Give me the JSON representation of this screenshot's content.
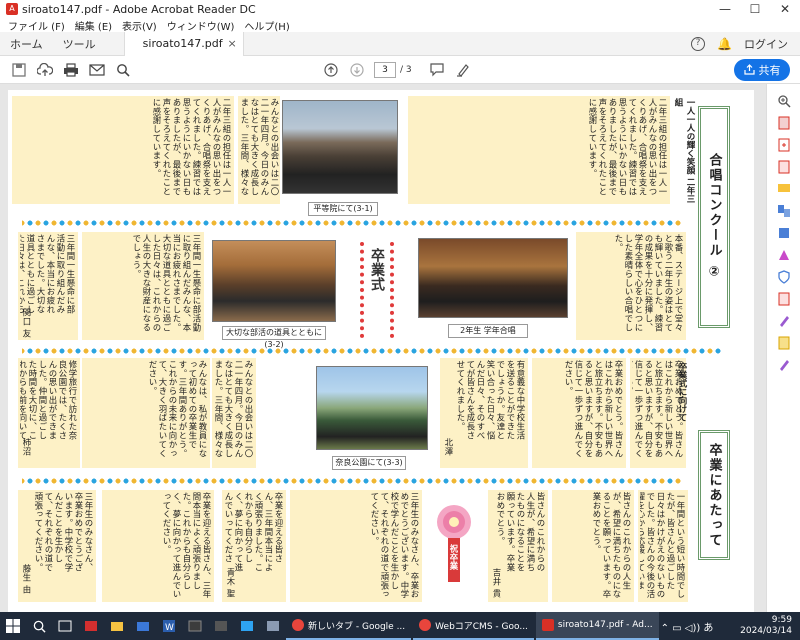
{
  "window": {
    "title": "siroato147.pdf - Adobe Acrobat Reader DC",
    "controls": [
      "—",
      "☐",
      "✕"
    ]
  },
  "menu": [
    "ファイル (F)",
    "編集 (E)",
    "表示(V)",
    "ウィンドウ(W)",
    "ヘルプ(H)"
  ],
  "tabs": {
    "home": "ホーム",
    "tools": "ツール",
    "document": "siroato147.pdf",
    "close": "×",
    "login": "ログイン"
  },
  "toolbar": {
    "page_current": "3",
    "page_total": "/ 3",
    "share": "共有"
  },
  "newsletter": {
    "headline_top": "合唱コンクール ②",
    "headline_bottom": "卒業にあたって",
    "ceremony_label": "卒業式",
    "graduation_badge": "祝卒業",
    "captions": {
      "byodoin": "平等院にて(3-1)",
      "club": "大切な部活の道具とともに(3-2)",
      "chorus": "2年生 学年合唱",
      "nara": "奈良公園にて(3-3)"
    },
    "section_titles": {
      "top_right": "一人一人の輝く笑顔 二年三組",
      "mid_right": "卒業式に向けて",
      "mid_right_b": "本番、ステージ上"
    },
    "authors": {
      "a1": "関口 友梨子",
      "a2": "柿沼 智",
      "a3": "北澤 清司",
      "a4": "藤生 由美子",
      "a5": "青木 聖悟",
      "a6": "吉井 貴晃"
    },
    "texts": {
      "t1": "二年三組の担任は一人一人がみんなの思い出をつくりあげ、合唱祭を支えてくれました。練習では思うようにいかない日もありましたが、最後まで声をそろえてくれたことに感謝しています。",
      "t2": "みんなとの出会いは二〇二一年四月。今日のみんなはとても大きく成長しました。三年間、様々な行事を通して、仲間と協力することの大切さを学んでくれたと思います。",
      "t3": "三年間一生懸命に部活動に取り組んだみんな、本当にお疲れさまでした。大切な道具とともに過ごした日々は、これからの人生の大きな財産になるでしょう。",
      "t4": "みんなは、私が教員になって初めての卒業生です。三年間ありがとう。これからの未来に向かって、大きく羽ばたいてください。",
      "t5": "本番、ステージ上で堂々と歌う二年生の姿はとても輝いていました。練習の成果を十分に発揮し、学年全体で心をひとつにした素晴らしい合唱でした。",
      "t6": "卒業おめでとう。皆さんはこれから新しい世界へと旅立ちます。不安もあると思いますが、自分を信じて一歩ずつ進んでください。",
      "t7": "修学旅行で訪れた奈良公園では、たくさんの思い出ができました。仲間と過ごした時間を大切に、これからも前を向いて歩んでいってください。",
      "t8": "有意義な中学校生活を送ることができたでしょうか。友達と笑い合った日々、悩んだ日々、そのすべてが皆さんを成長させてくれました。",
      "t9": "一年間という短い時間でしたが、皆さんと過ごした日々はかけがえのないものでした。皆さんの今後の活躍を心から応援しています。",
      "t10": "三年生のみなさん、卒業おめでとうございます。中学校で学んだことを生かして、それぞれの道で頑張ってください。",
      "t11": "卒業を迎える皆さん、三年間本当によく頑張りました。これからも自分らしく、夢に向かって進んでいってください。",
      "t12": "皆さんのこれからの人生が、希望に満ちたものになることを願っています。卒業おめでとう。"
    }
  },
  "taskbar": {
    "search_placeholder": "",
    "app1": "新しいタブ - Google ...",
    "app2": "WebコアCMS - Goo...",
    "app3": "siroato147.pdf - Ad...",
    "time": "9:59",
    "date": "2024/03/14"
  }
}
